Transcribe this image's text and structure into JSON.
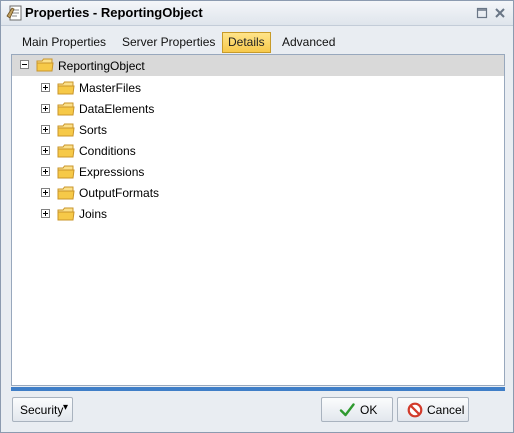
{
  "window": {
    "title": "Properties - ReportingObject"
  },
  "tabs": [
    {
      "label": "Main Properties",
      "active": false
    },
    {
      "label": "Server Properties",
      "active": false
    },
    {
      "label": "Details",
      "active": true
    },
    {
      "label": "Advanced",
      "active": false
    }
  ],
  "tree": {
    "root": {
      "label": "ReportingObject",
      "expanded": true
    },
    "children": [
      {
        "label": "MasterFiles",
        "expanded": false
      },
      {
        "label": "DataElements",
        "expanded": false
      },
      {
        "label": "Sorts",
        "expanded": false
      },
      {
        "label": "Conditions",
        "expanded": false
      },
      {
        "label": "Expressions",
        "expanded": false
      },
      {
        "label": "OutputFormats",
        "expanded": false
      },
      {
        "label": "Joins",
        "expanded": false
      }
    ]
  },
  "footer": {
    "security_label": "Security",
    "security_arrow": "▾",
    "ok_label": "OK",
    "cancel_label": "Cancel"
  },
  "colors": {
    "active_tab": "#f7c94b",
    "separator": "#3f7ec7",
    "ok_icon": "#2f9a2f",
    "cancel_icon": "#d23b2b",
    "folder": "#f3c846"
  },
  "icons": {
    "app": "properties-icon",
    "maximize": "maximize-icon",
    "close": "close-icon",
    "expand": "plus-icon",
    "collapse": "minus-icon",
    "folder": "folder-icon",
    "ok": "checkmark-icon",
    "cancel": "no-entry-icon"
  }
}
